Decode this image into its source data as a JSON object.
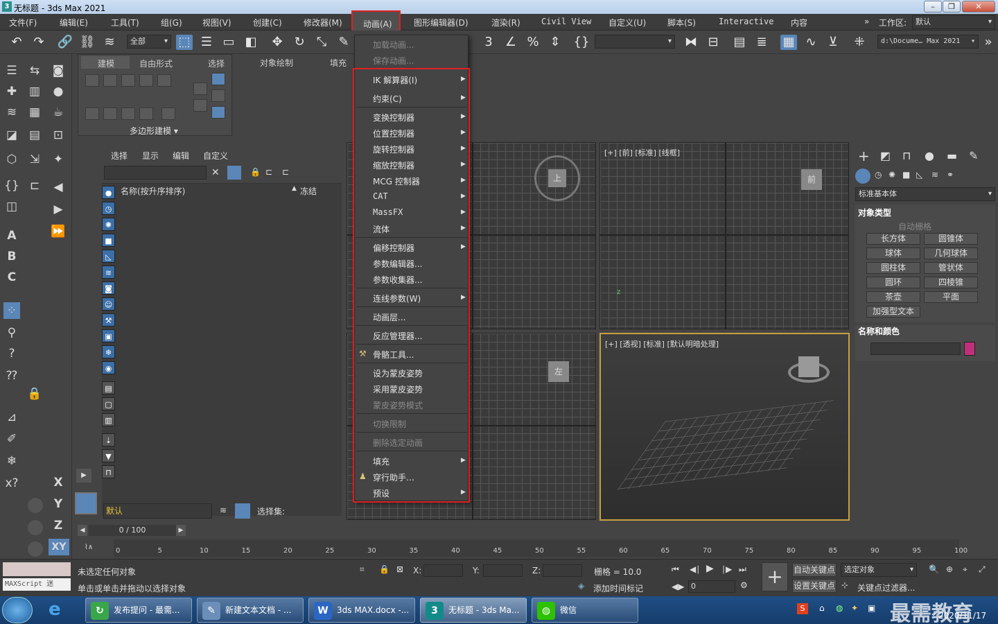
{
  "title": "无标题 - 3ds Max 2021",
  "window_controls": [
    "–",
    "❐",
    "✕"
  ],
  "menubar": {
    "items": [
      "文件(F)",
      "编辑(E)",
      "工具(T)",
      "组(G)",
      "视图(V)",
      "创建(C)",
      "修改器(M)",
      "动画(A)",
      "图形编辑器(D)",
      "渲染(R)",
      "Civil View",
      "自定义(U)",
      "脚本(S)",
      "Interactive",
      "内容"
    ],
    "workspace_label": "工作区:",
    "workspace_value": "默认",
    "more": "»"
  },
  "toolbar": {
    "selection_filter": "全部",
    "path": "d:\\Docume… Max 2021"
  },
  "ribbon": {
    "tabs": [
      "建模",
      "自由形式",
      "选择",
      "对象绘制",
      "填充"
    ],
    "footer": "多边形建模 ▾"
  },
  "scene_explorer": {
    "tabs": [
      "选择",
      "显示",
      "编辑",
      "自定义"
    ],
    "col_name": "名称(按升序排序)",
    "col_freeze": "冻结",
    "layer_value": "默认",
    "selection_set_label": "选择集:"
  },
  "viewports": {
    "front_label": "[+] [前] [标准] [线框]",
    "persp_label": "[+] [透视] [标准] [默认明暗处理]",
    "cube_top": "上",
    "cube_front": "前",
    "cube_left": "左"
  },
  "command_panel": {
    "category": "标准基本体",
    "rollout_object_type": "对象类型",
    "auto_grid": "自动栅格",
    "buttons": [
      "长方体",
      "圆锥体",
      "球体",
      "几何球体",
      "圆柱体",
      "管状体",
      "圆环",
      "四棱锥",
      "茶壶",
      "平面",
      "加强型文本"
    ],
    "rollout_name_color": "名称和颜色",
    "color": "#c0307a"
  },
  "anim_menu": {
    "items": [
      {
        "label": "加载动画...",
        "disabled": true,
        "sub": false
      },
      {
        "label": "保存动画...",
        "disabled": true,
        "sub": false
      },
      {
        "label": "IK 解算器(I)",
        "disabled": false,
        "sub": true
      },
      {
        "label": "约束(C)",
        "disabled": false,
        "sub": true
      },
      {
        "label": "变换控制器",
        "disabled": false,
        "sub": true
      },
      {
        "label": "位置控制器",
        "disabled": false,
        "sub": true
      },
      {
        "label": "旋转控制器",
        "disabled": false,
        "sub": true
      },
      {
        "label": "缩放控制器",
        "disabled": false,
        "sub": true
      },
      {
        "label": "MCG 控制器",
        "disabled": false,
        "sub": true
      },
      {
        "label": "CAT",
        "disabled": false,
        "sub": true
      },
      {
        "label": "MassFX",
        "disabled": false,
        "sub": true
      },
      {
        "label": "流体",
        "disabled": false,
        "sub": true
      },
      {
        "label": "偏移控制器",
        "disabled": false,
        "sub": true
      },
      {
        "label": "参数编辑器...",
        "disabled": false,
        "sub": false
      },
      {
        "label": "参数收集器...",
        "disabled": false,
        "sub": false
      },
      {
        "label": "连线参数(W)",
        "disabled": false,
        "sub": true
      },
      {
        "label": "动画层...",
        "disabled": false,
        "sub": false
      },
      {
        "label": "反应管理器...",
        "disabled": false,
        "sub": false
      },
      {
        "label": "骨骼工具...",
        "disabled": false,
        "sub": false
      },
      {
        "label": "设为蒙皮姿势",
        "disabled": false,
        "sub": false
      },
      {
        "label": "采用蒙皮姿势",
        "disabled": false,
        "sub": false
      },
      {
        "label": "蒙皮姿势模式",
        "disabled": true,
        "sub": false
      },
      {
        "label": "切换限制",
        "disabled": true,
        "sub": false
      },
      {
        "label": "删除选定动画",
        "disabled": true,
        "sub": false
      },
      {
        "label": "填充",
        "disabled": false,
        "sub": true
      },
      {
        "label": "穿行助手…",
        "disabled": false,
        "sub": false
      },
      {
        "label": "预设",
        "disabled": false,
        "sub": true
      }
    ]
  },
  "timeline": {
    "frame": "0 / 100",
    "ticks": [
      "0",
      "5",
      "10",
      "15",
      "20",
      "25",
      "30",
      "35",
      "40",
      "45",
      "50",
      "55",
      "60",
      "65",
      "70",
      "75",
      "80",
      "85",
      "90",
      "95",
      "100"
    ]
  },
  "status": {
    "maxscript": "MAXScript 迷",
    "line1": "未选定任何对象",
    "line2": "单击或单击并拖动以选择对象",
    "x": "X:",
    "y": "Y:",
    "z": "Z:",
    "grid": "栅格 = 10.0",
    "add_time_tag": "添加时间标记",
    "auto_key": "自动关键点",
    "selected": "选定对象",
    "set_key": "设置关键点",
    "key_filter": "关键点过滤器...",
    "frame_field": "0"
  },
  "taskbar": {
    "tasks": [
      "发布提问 - 最需...",
      "新建文本文档 - ...",
      "3ds MAX.docx -...",
      "无标题 - 3ds Ma...",
      "微信"
    ],
    "date": "2020/11/17",
    "watermark": "最需教育"
  },
  "viewcube_labels": {
    "axis_x": "x",
    "axis_y": "y",
    "axis_z": "z"
  }
}
